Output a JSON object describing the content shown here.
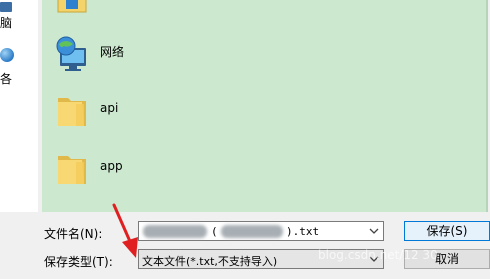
{
  "nav": {
    "items": [
      {
        "label": "脑",
        "icon": "monitor-icon"
      },
      {
        "label": "各",
        "icon": "globe-icon"
      }
    ]
  },
  "files": [
    {
      "name": "",
      "icon": "folder-icon-partial"
    },
    {
      "name": "网络",
      "icon": "network-icon"
    },
    {
      "name": "api",
      "icon": "folder-icon"
    },
    {
      "name": "app",
      "icon": "folder-icon"
    },
    {
      "name": "",
      "icon": "folder-icon-partial"
    }
  ],
  "form": {
    "filename_label": "文件名(N):",
    "filename_value_end": ").txt",
    "filename_paren": "(",
    "filetype_label": "保存类型(T):",
    "filetype_value": "文本文件(*.txt,不支持导入)",
    "save_label": "保存(S)",
    "cancel_label": "取消"
  },
  "watermark": "blog.csdn.net/12    30",
  "colors": {
    "list_background": "#cce8cf",
    "arrow": "#e02020",
    "folder": "#f4d46a"
  }
}
